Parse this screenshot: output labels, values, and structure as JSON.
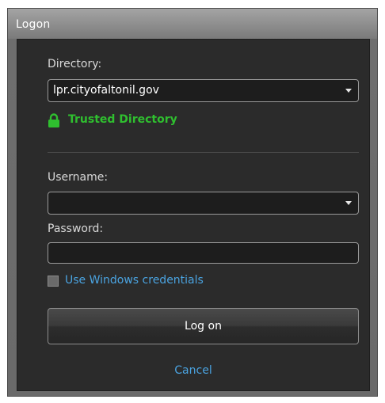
{
  "window": {
    "title": "Logon"
  },
  "form": {
    "directory_label": "Directory:",
    "directory_value": "lpr.cityofaltonil.gov",
    "trusted_text": "Trusted Directory",
    "username_label": "Username:",
    "username_value": "",
    "password_label": "Password:",
    "password_value": "",
    "windows_credentials_label": "Use Windows credentials",
    "windows_credentials_checked": false
  },
  "actions": {
    "logon_label": "Log on",
    "cancel_label": "Cancel"
  },
  "icons": {
    "lock": "lock-icon",
    "dropdown": "chevron-down-icon"
  },
  "colors": {
    "trusted_green": "#2fbf2f",
    "link_blue": "#4aa3e0",
    "panel_bg": "#2b2b2b"
  }
}
